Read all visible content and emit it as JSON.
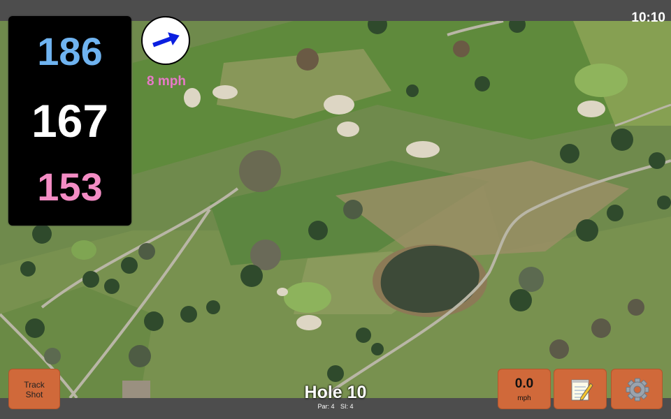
{
  "clock": "10:10",
  "distances": {
    "back": "186",
    "middle": "167",
    "front": "153",
    "back_color": "#6fb3f0",
    "middle_color": "#ffffff",
    "front_color": "#f38cc4"
  },
  "wind": {
    "speed_label": "8 mph",
    "speed_color": "#e879c8",
    "arrow_color": "#0b1fe0",
    "arrow_icon": "wind-direction-arrow"
  },
  "buttons": {
    "track_line1": "Track",
    "track_line2": "Shot",
    "wind_value": "0.0",
    "wind_unit": "mph",
    "notes_icon": "notepad-icon",
    "settings_icon": "gear-icon",
    "button_color": "#d0693a"
  },
  "hole": {
    "title": "Hole 10",
    "par": "Par: 4",
    "si": "SI: 4"
  }
}
